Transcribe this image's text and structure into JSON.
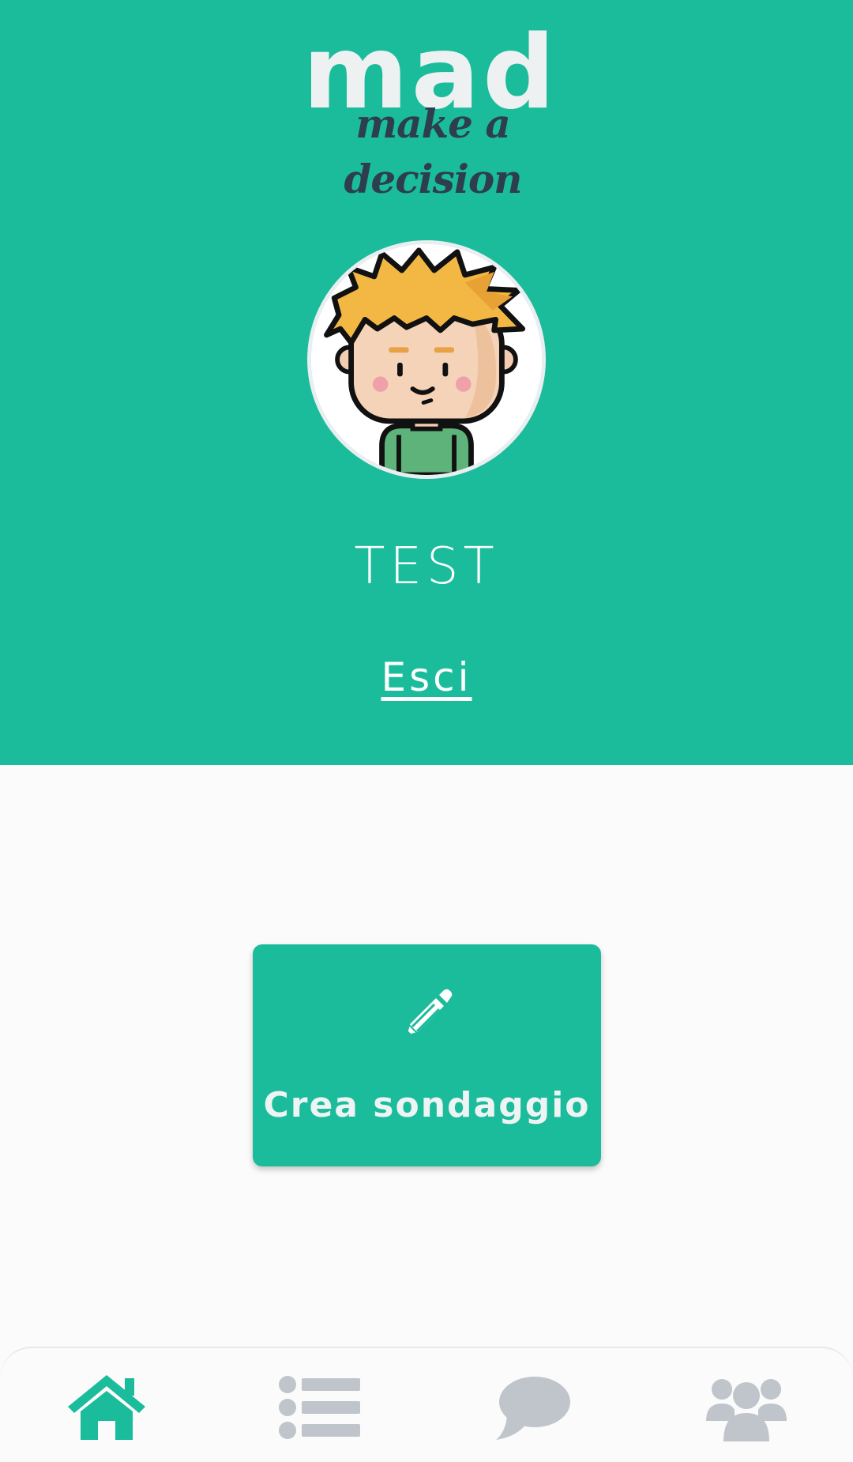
{
  "header": {
    "logo_text": "mad",
    "logo_tagline": "make a decision"
  },
  "profile": {
    "avatar": "boy-avatar-illustration",
    "username": "TEST",
    "logout_label": "Esci"
  },
  "main": {
    "create_poll_label": "Crea sondaggio",
    "create_poll_icon": "pencil-icon"
  },
  "bottom_nav": {
    "items": [
      {
        "icon": "home-icon",
        "active": true
      },
      {
        "icon": "list-icon",
        "active": false
      },
      {
        "icon": "chat-icon",
        "active": false
      },
      {
        "icon": "group-icon",
        "active": false
      }
    ]
  },
  "colors": {
    "brand": "#1bbc9b",
    "background": "#fcfbfb",
    "nav_inactive": "#bfc5cb",
    "logo_dark": "#2d3e50"
  }
}
